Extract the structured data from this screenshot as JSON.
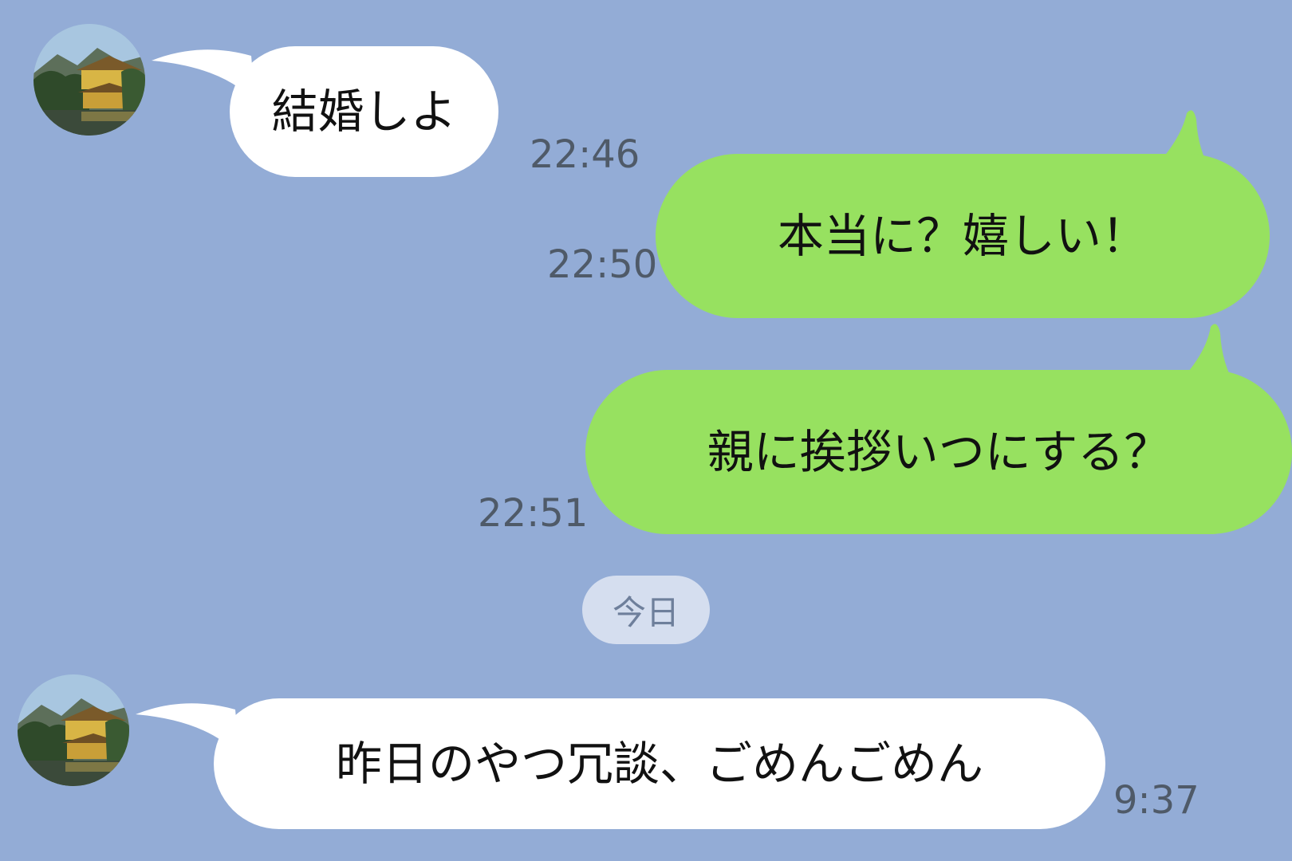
{
  "chat": {
    "date_separator": "今日",
    "messages": [
      {
        "sender": "other",
        "text": "結婚しよ",
        "time": "22:46"
      },
      {
        "sender": "me",
        "text": "本当に？嬉しい！",
        "time": "22:50"
      },
      {
        "sender": "me",
        "text": "親に挨拶いつにする？",
        "time": "22:51"
      },
      {
        "sender": "other",
        "text": "昨日のやつ冗談、ごめんごめん",
        "time": "9:37"
      }
    ]
  },
  "avatar_icon": "temple-photo-icon",
  "colors": {
    "background": "#93acd6",
    "incoming_bubble": "#ffffff",
    "outgoing_bubble": "#97e160",
    "time_text": "#4f5a68",
    "date_chip": "#d5deef"
  }
}
